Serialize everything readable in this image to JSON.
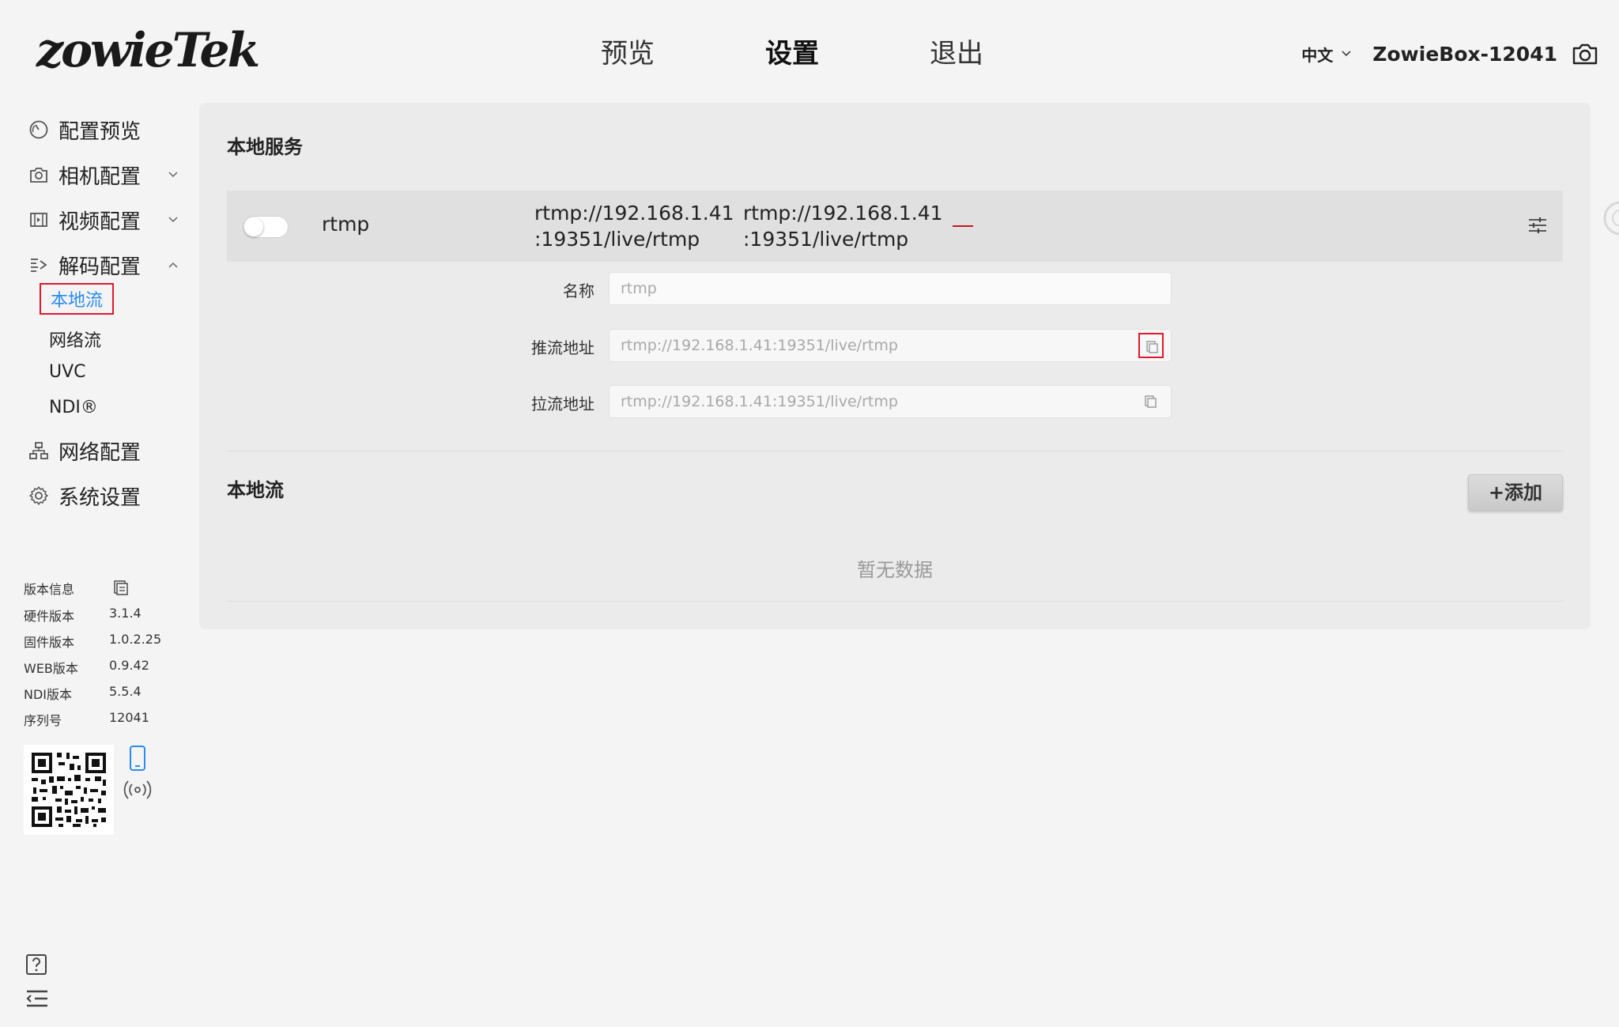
{
  "logo": {
    "text": "zowieTek"
  },
  "nav": [
    {
      "label": "预览",
      "active": false
    },
    {
      "label": "设置",
      "active": true
    },
    {
      "label": "退出",
      "active": false
    }
  ],
  "header": {
    "language": "中文",
    "device_name": "ZowieBox-12041",
    "camera_icon": "camera-icon"
  },
  "sidebar": {
    "menu": [
      {
        "label": "配置预览",
        "icon": "gauge-icon"
      },
      {
        "label": "相机配置",
        "icon": "camera-icon",
        "expanded": false
      },
      {
        "label": "视频配置",
        "icon": "film-icon",
        "expanded": false
      },
      {
        "label": "解码配置",
        "icon": "decode-icon",
        "expanded": true
      },
      {
        "label": "网络配置",
        "icon": "network-icon"
      },
      {
        "label": "系统设置",
        "icon": "gear-icon"
      }
    ],
    "submenu": [
      {
        "label": "本地流",
        "active": true
      },
      {
        "label": "网络流",
        "active": false
      },
      {
        "label": "UVC",
        "active": false
      },
      {
        "label": "NDI®",
        "active": false
      }
    ]
  },
  "version": {
    "title": "版本信息",
    "rows": [
      {
        "key": "硬件版本",
        "value": "3.1.4"
      },
      {
        "key": "固件版本",
        "value": "1.0.2.25"
      },
      {
        "key": "WEB版本",
        "value": "0.9.42"
      },
      {
        "key": "NDI版本",
        "value": "5.5.4"
      },
      {
        "key": "序列号",
        "value": "12041"
      }
    ]
  },
  "main": {
    "local_service": {
      "title": "本地服务",
      "service": {
        "enabled": false,
        "name": "rtmp",
        "push_url_line1": "rtmp://192.168.1.41",
        "push_url_line2": ":19351/live/rtmp",
        "pull_url_line1": "rtmp://192.168.1.41",
        "pull_url_line2": ":19351/live/rtmp"
      },
      "form": {
        "name_label": "名称",
        "name_value": "rtmp",
        "push_label": "推流地址",
        "push_value": "rtmp://192.168.1.41:19351/live/rtmp",
        "pull_label": "拉流地址",
        "pull_value": "rtmp://192.168.1.41:19351/live/rtmp"
      }
    },
    "local_stream": {
      "title": "本地流",
      "add_label": "+添加",
      "empty_text": "暂无数据"
    }
  },
  "colors": {
    "accent_blue": "#2a8bf2",
    "highlight_red": "#e0192f",
    "brand_red": "#e4122b"
  }
}
